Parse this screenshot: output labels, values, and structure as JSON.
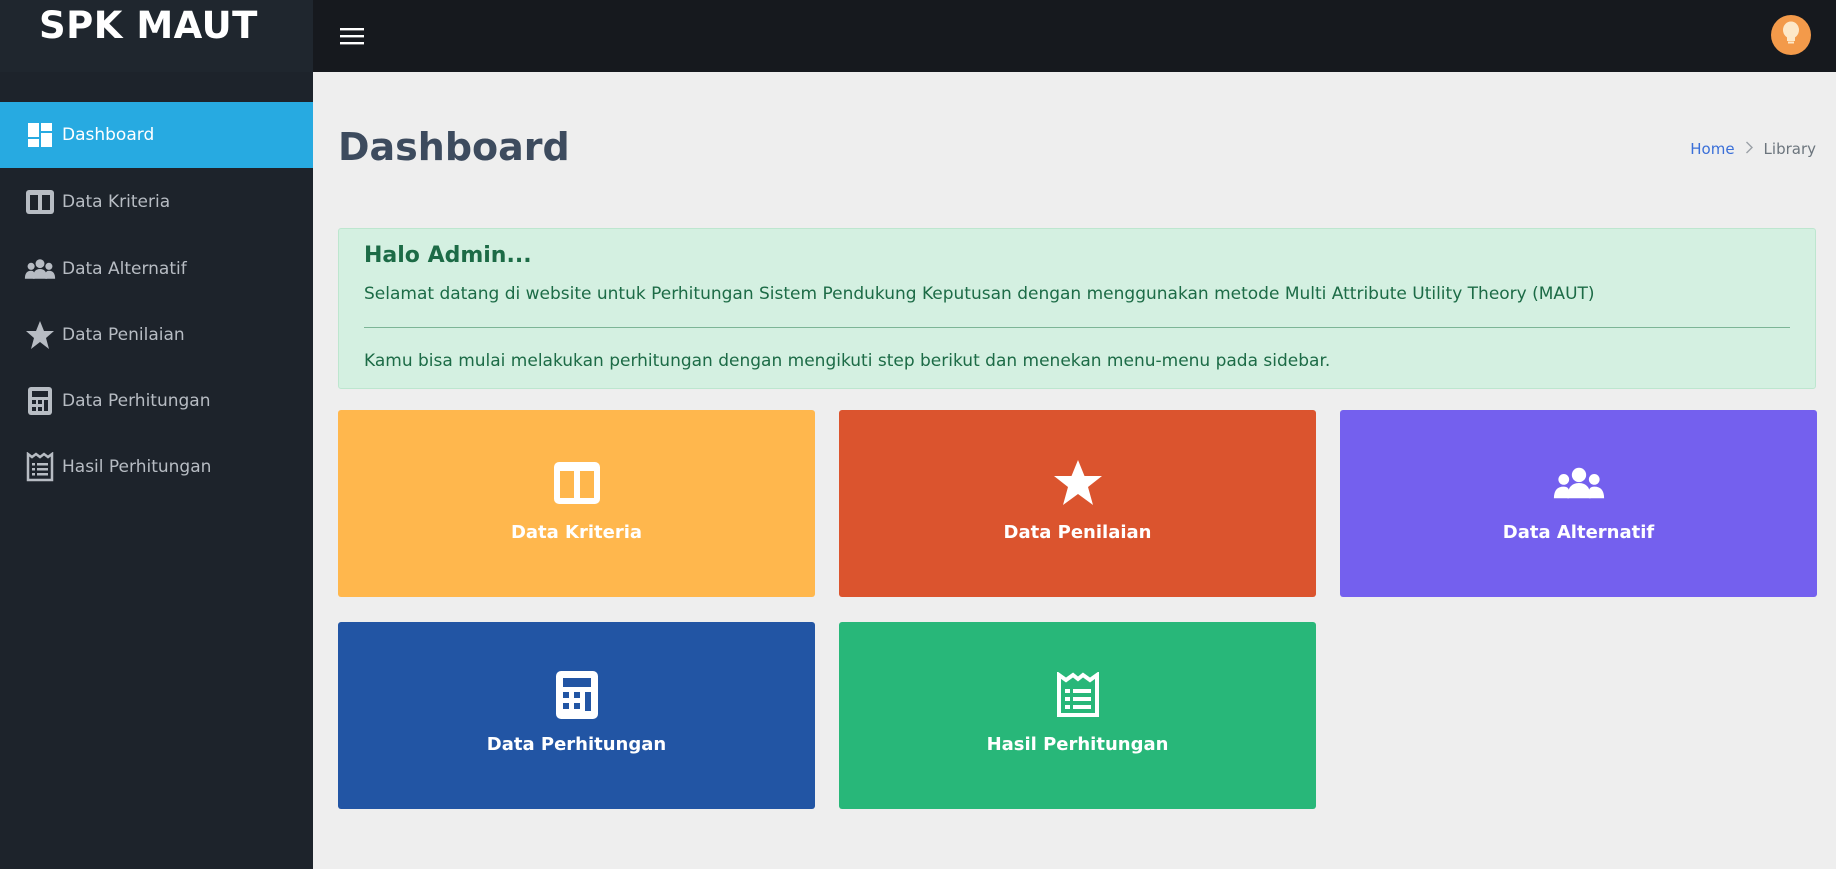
{
  "app": {
    "brand": "SPK MAUT"
  },
  "sidebar": {
    "items": [
      {
        "label": "Dashboard",
        "icon": "dashboard-icon",
        "active": true
      },
      {
        "label": "Data Kriteria",
        "icon": "columns-icon"
      },
      {
        "label": "Data Alternatif",
        "icon": "users-icon"
      },
      {
        "label": "Data Penilaian",
        "icon": "star-icon"
      },
      {
        "label": "Data Perhitungan",
        "icon": "calculator-icon"
      },
      {
        "label": "Hasil Perhitungan",
        "icon": "receipt-icon"
      }
    ]
  },
  "topbar": {
    "menu_icon": "hamburger-icon",
    "avatar_icon": "lightbulb-icon"
  },
  "page": {
    "title": "Dashboard",
    "breadcrumb": {
      "home": "Home",
      "current": "Library"
    }
  },
  "alert": {
    "title": "Halo Admin...",
    "text1": "Selamat datang di website untuk Perhitungan Sistem Pendukung Keputusan dengan menggunakan metode Multi Attribute Utility Theory (MAUT)",
    "text2": "Kamu bisa mulai melakukan perhitungan dengan mengikuti step berikut dan menekan menu-menu pada sidebar."
  },
  "cards": [
    {
      "label": "Data Kriteria",
      "icon": "columns-icon",
      "color": "#ffb74d"
    },
    {
      "label": "Data Penilaian",
      "icon": "star-icon",
      "color": "#db542e"
    },
    {
      "label": "Data Alternatif",
      "icon": "users-icon",
      "color": "#7460ee"
    },
    {
      "label": "Data Perhitungan",
      "icon": "calculator-icon",
      "color": "#2255a4"
    },
    {
      "label": "Hasil Perhitungan",
      "icon": "receipt-icon",
      "color": "#28b779"
    }
  ],
  "colors": {
    "sidebar_bg": "#1d232b",
    "active_item": "#27aae1",
    "topbar_bg": "#16191e",
    "avatar": "#f39a4a",
    "alert_bg": "#d4f0e1",
    "alert_text": "#1c6b46"
  }
}
